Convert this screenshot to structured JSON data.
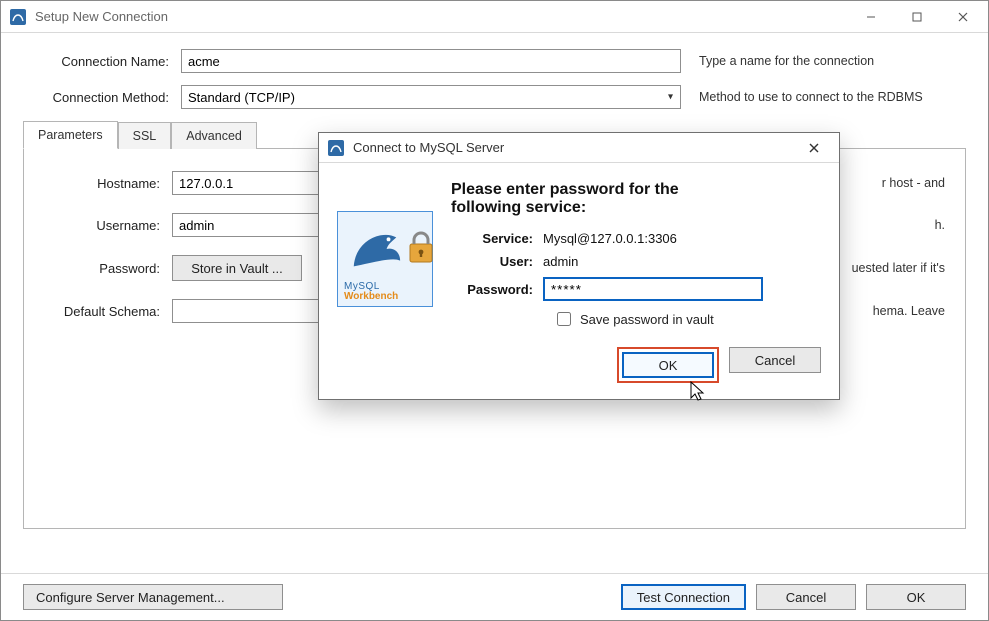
{
  "main_window": {
    "title": "Setup New Connection",
    "form": {
      "connection_name_label": "Connection Name:",
      "connection_name_value": "acme",
      "connection_name_hint": "Type a name for the connection",
      "connection_method_label": "Connection Method:",
      "connection_method_value": "Standard (TCP/IP)",
      "connection_method_hint": "Method to use to connect to the RDBMS"
    },
    "tabs": {
      "parameters": "Parameters",
      "ssl": "SSL",
      "advanced": "Advanced"
    },
    "parameters_panel": {
      "hostname_label": "Hostname:",
      "hostname_value": "127.0.0.1",
      "hostname_hint_fragment": "r host - and",
      "username_label": "Username:",
      "username_value": "admin",
      "username_hint_fragment": "h.",
      "password_label": "Password:",
      "store_vault_button": "Store in Vault ...",
      "password_hint_fragment": "uested later if it's",
      "default_schema_label": "Default Schema:",
      "default_schema_value": "",
      "default_schema_hint_fragment": "hema. Leave"
    },
    "footer": {
      "configure_button": "Configure Server Management...",
      "test_connection_button": "Test Connection",
      "cancel_button": "Cancel",
      "ok_button": "OK"
    }
  },
  "password_dialog": {
    "title": "Connect to MySQL Server",
    "heading_line1": "Please enter password for the",
    "heading_line2": "following service:",
    "service_label": "Service:",
    "service_value": "Mysql@127.0.0.1:3306",
    "user_label": "User:",
    "user_value": "admin",
    "password_label": "Password:",
    "password_value": "*****",
    "save_vault_label": "Save password in vault",
    "save_vault_checked": false,
    "logo_brand_top": "MySQL",
    "logo_brand_bottom": "Workbench",
    "ok_button": "OK",
    "cancel_button": "Cancel"
  }
}
